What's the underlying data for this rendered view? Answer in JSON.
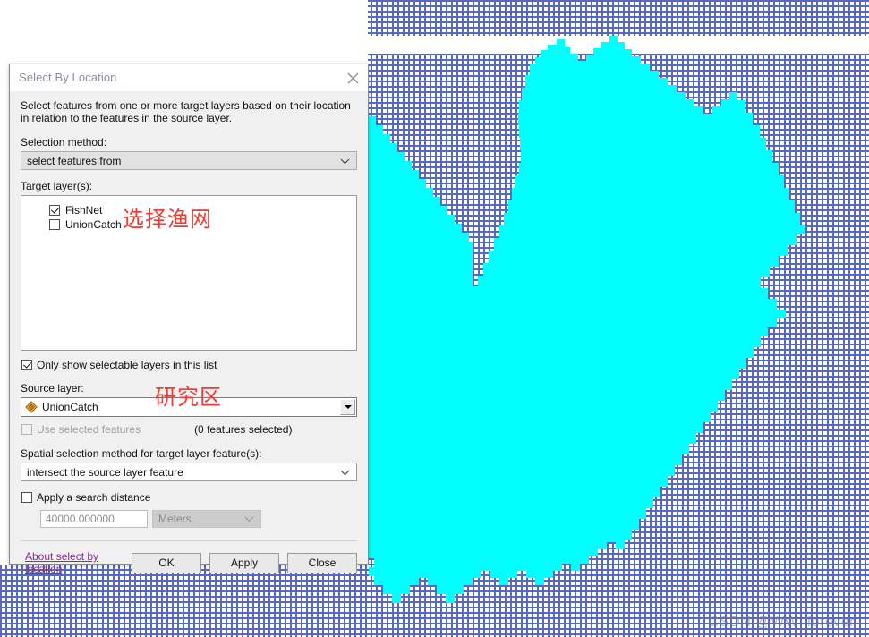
{
  "dialog": {
    "title": "Select By Location",
    "close_icon": "close-icon",
    "description": "Select features from one or more target layers based on their location in relation to the features in the source layer.",
    "selection_method": {
      "label": "Selection method:",
      "value": "select features from",
      "chevron_icon": "chevron-down-icon"
    },
    "target_layers": {
      "label": "Target layer(s):",
      "items": [
        {
          "name": "FishNet",
          "checked": true
        },
        {
          "name": "UnionCatch",
          "checked": false
        }
      ]
    },
    "only_selectable": {
      "label": "Only show selectable layers in this list",
      "checked": true
    },
    "source_layer": {
      "label": "Source layer:",
      "value": "UnionCatch",
      "layer_icon": "polygon-layer-icon",
      "dropdown_icon": "triangle-down-icon"
    },
    "use_selected": {
      "label": "Use selected features",
      "checked": false,
      "disabled": true,
      "count_text": "(0 features selected)"
    },
    "spatial_method": {
      "label": "Spatial selection method for target layer feature(s):",
      "value": "intersect the source layer feature",
      "chevron_icon": "chevron-down-icon"
    },
    "search_distance": {
      "label": "Apply a search distance",
      "checked": false,
      "value": "40000.000000",
      "unit": "Meters",
      "unit_chevron_icon": "chevron-down-icon"
    },
    "footer": {
      "about_link": "About select by location",
      "ok_label": "OK",
      "apply_label": "Apply",
      "close_label": "Close"
    }
  },
  "annotations": [
    {
      "id": "fishnet",
      "text": "选择渔网",
      "color": "#ee3b33"
    },
    {
      "id": "study-area",
      "text": "研究区",
      "color": "#ee3b33"
    }
  ],
  "map": {
    "polygon_fill": "#00ffff",
    "fishnet_grid_color": "#5566bb",
    "background": "#ffffff",
    "polygon_name": "UnionCatch study area polygon",
    "grid_name": "FishNet grid"
  },
  "watermark": {
    "text": "CSDN @WW_forever"
  }
}
